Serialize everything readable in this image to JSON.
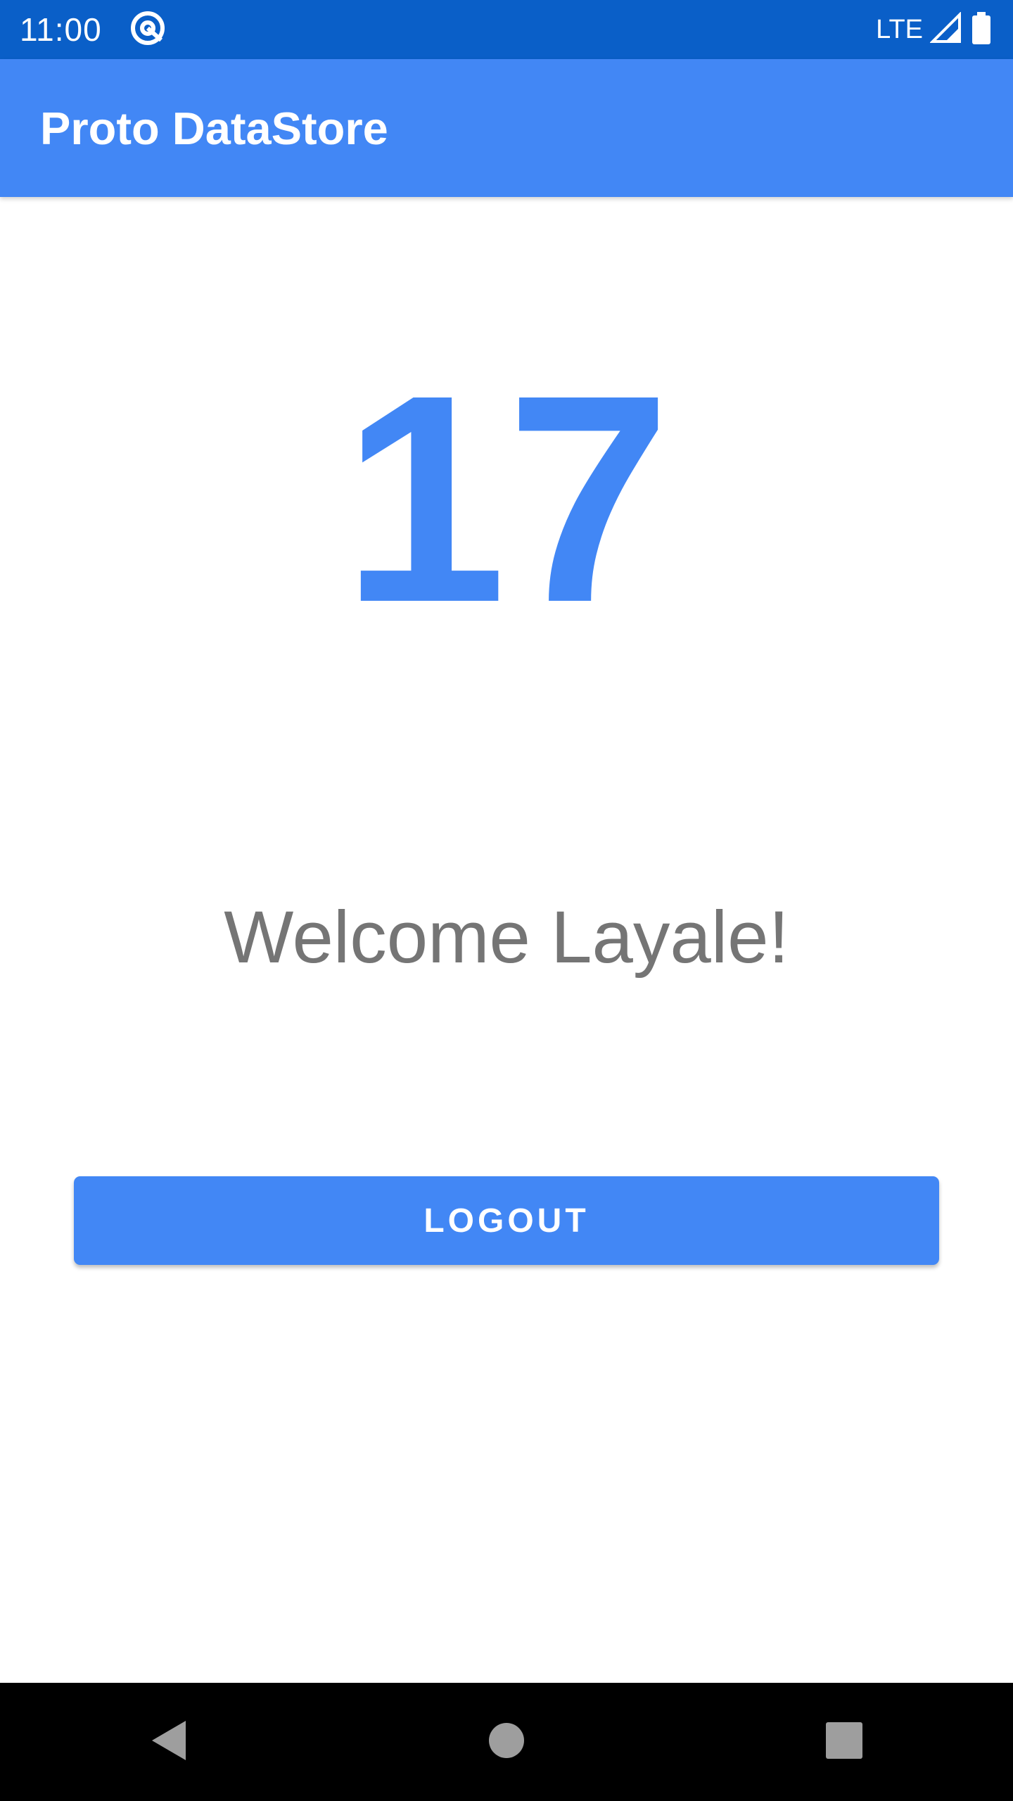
{
  "status_bar": {
    "time": "11:00",
    "network": "LTE",
    "icons": [
      "at-sign-icon",
      "signal-icon",
      "battery-icon"
    ]
  },
  "app_bar": {
    "title": "Proto DataStore"
  },
  "main": {
    "counter": "17",
    "welcome_text": "Welcome Layale!",
    "logout_label": "LOGOUT"
  },
  "nav_bar": {
    "buttons": [
      "back-icon",
      "home-icon",
      "recents-icon"
    ]
  },
  "colors": {
    "status_bar": "#0a5fc8",
    "primary": "#4287f5",
    "welcome_text": "#757575",
    "nav_bar": "#000000"
  }
}
